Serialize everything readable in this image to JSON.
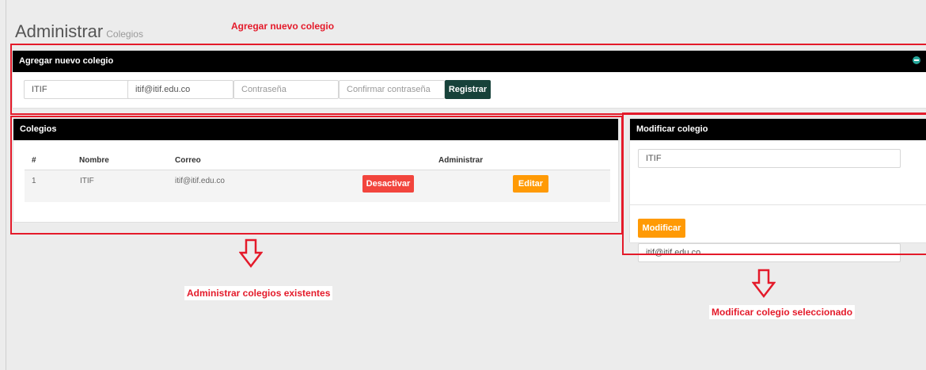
{
  "page": {
    "title": "Administrar",
    "subtitle": "Colegios"
  },
  "annotations": {
    "add": "Agregar nuevo colegio",
    "manage": "Administrar colegios existentes",
    "modify": "Modificar colegio seleccionado"
  },
  "add_panel": {
    "header": "Agregar nuevo colegio",
    "name_value": "ITIF",
    "email_value": "itif@itif.edu.co",
    "password_placeholder": "Contraseña",
    "confirm_placeholder": "Confirmar contraseña",
    "register_label": "Registrar"
  },
  "list_panel": {
    "header": "Colegios",
    "columns": {
      "num": "#",
      "name": "Nombre",
      "email": "Correo",
      "admin": "Administrar"
    },
    "rows": [
      {
        "num": "1",
        "name": "ITIF",
        "email": "itif@itif.edu.co",
        "deactivate": "Desactivar",
        "edit": "Editar"
      }
    ]
  },
  "edit_panel": {
    "header": "Modificar colegio",
    "name_value": "ITIF",
    "email_value": "itif@itif.edu.co",
    "modify_label": "Modificar"
  },
  "colors": {
    "accent_red": "#e41a2a",
    "header_bg": "#000000",
    "register_btn": "#17423a",
    "deactivate_btn": "#f2453d",
    "edit_btn": "#ff9a05",
    "toggle_icon": "#26a69a"
  }
}
